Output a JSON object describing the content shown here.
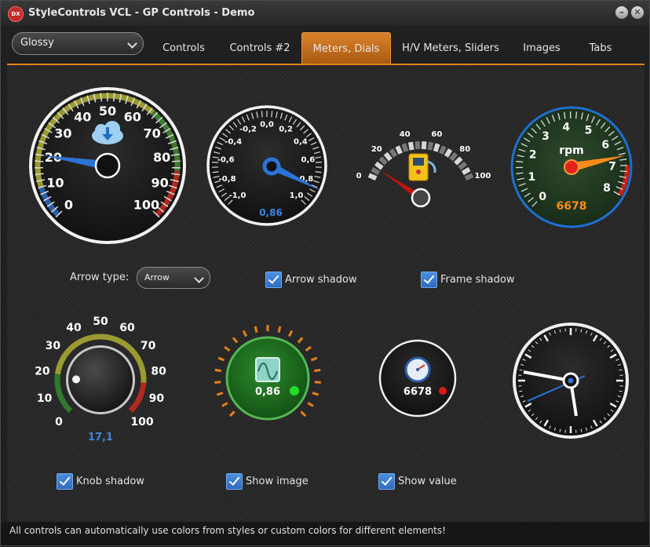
{
  "window": {
    "title": "StyleControls VCL - GP Controls - Demo",
    "icon_text": "DX"
  },
  "style_combo": {
    "value": "Glossy"
  },
  "tabs": [
    {
      "label": "Controls"
    },
    {
      "label": "Controls #2"
    },
    {
      "label": "Meters, Dials",
      "active": true
    },
    {
      "label": "H/V Meters, Sliders"
    },
    {
      "label": "Images"
    },
    {
      "label": "Tabs"
    }
  ],
  "gauge1": {
    "ticks": [
      "0",
      "10",
      "20",
      "30",
      "40",
      "50",
      "60",
      "70",
      "80",
      "90",
      "100"
    ],
    "value": 20,
    "icon": "cloud-download-icon"
  },
  "gauge2": {
    "ticks": [
      "-1,0",
      "-0,8",
      "-0,6",
      "-0,4",
      "-0,2",
      "0,0",
      "0,2",
      "0,4",
      "0,6",
      "0,8",
      "1,0"
    ],
    "value_text": "0,86",
    "value": 0.86
  },
  "gauge3": {
    "ticks": [
      "0",
      "20",
      "40",
      "60",
      "80",
      "100"
    ],
    "value": 10,
    "icon": "fuel-pump-icon"
  },
  "gauge4": {
    "ticks": [
      "0",
      "1",
      "2",
      "3",
      "4",
      "5",
      "6",
      "7",
      "8"
    ],
    "unit": "rpm",
    "value_text": "6678",
    "value": 6678
  },
  "options_row1": {
    "arrow_type_label": "Arrow type:",
    "arrow_type_value": "Arrow",
    "arrow_shadow_label": "Arrow shadow",
    "frame_shadow_label": "Frame shadow",
    "arrow_shadow_checked": true,
    "frame_shadow_checked": true
  },
  "knob": {
    "ticks": [
      "0",
      "10",
      "20",
      "30",
      "40",
      "50",
      "60",
      "70",
      "80",
      "90",
      "100"
    ],
    "value_text": "17,1",
    "value": 17.1
  },
  "dial_image": {
    "value_text": "0,86",
    "icon": "waveform-icon"
  },
  "dial_small": {
    "value_text": "6678",
    "icon": "speedometer-icon"
  },
  "clock": {},
  "options_row2": {
    "knob_shadow_label": "Knob shadow",
    "show_image_label": "Show image",
    "show_value_label": "Show value",
    "knob_shadow_checked": true,
    "show_image_checked": true,
    "show_value_checked": true
  },
  "status": {
    "text": "All controls can automatically use colors from styles or custom colors for different elements!"
  },
  "colors": {
    "accent": "#e3821a",
    "needle_blue": "#3a7bd5",
    "needle_orange": "#ff8c1a",
    "needle_red": "#c51010"
  }
}
